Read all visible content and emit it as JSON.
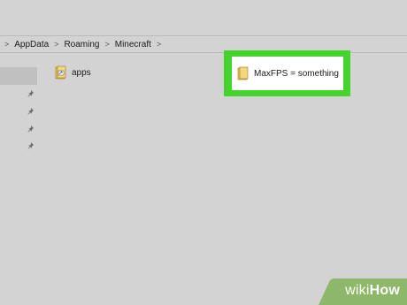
{
  "breadcrumb": {
    "items": [
      "AppData",
      "Roaming",
      "Minecraft"
    ],
    "separator": ">"
  },
  "files": [
    {
      "name": "apps",
      "icon": "folder-shortcut-icon"
    },
    {
      "name": "MaxFPS = something",
      "icon": "folder-icon",
      "highlighted": true
    }
  ],
  "highlight_color": "#45d42e",
  "watermark": {
    "wiki": "wiki",
    "how": "How"
  }
}
